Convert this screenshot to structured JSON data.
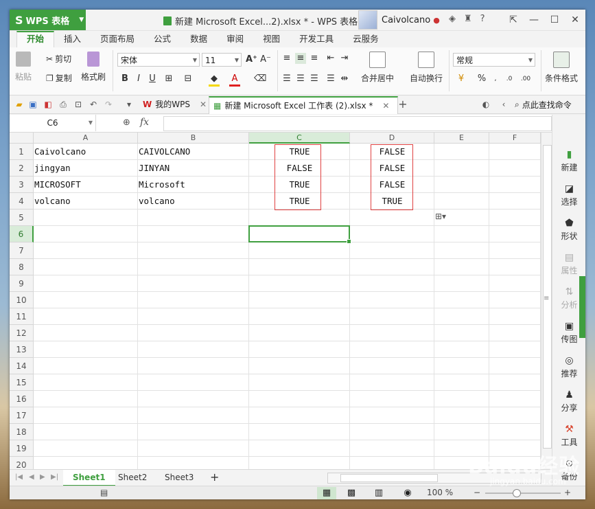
{
  "titlebar": {
    "app_name": "WPS 表格",
    "document_title": "新建 Microsoft Excel...2).xlsx * - WPS 表格",
    "username": "Caivolcano"
  },
  "ribbon_tabs": [
    "开始",
    "插入",
    "页面布局",
    "公式",
    "数据",
    "审阅",
    "视图",
    "开发工具",
    "云服务"
  ],
  "ribbon": {
    "paste": "粘贴",
    "cut": "剪切",
    "copy": "复制",
    "format_painter": "格式刷",
    "font_name": "宋体",
    "font_size": "11",
    "merge_center": "合并居中",
    "wrap_text": "自动换行",
    "number_format": "常规",
    "conditional_format": "条件格式"
  },
  "doc_tabs": {
    "my_wps": "我的WPS",
    "workbook": "新建 Microsoft Excel 工作表 (2).xlsx *",
    "search": "点此查找命令"
  },
  "formula_bar": {
    "name_box": "C6",
    "fx": "fx",
    "formula": ""
  },
  "sheet": {
    "columns": [
      "A",
      "B",
      "C",
      "D",
      "E",
      "F"
    ],
    "rows": [
      "1",
      "2",
      "3",
      "4",
      "5",
      "6",
      "7",
      "8",
      "9",
      "10",
      "11",
      "12",
      "13",
      "14",
      "15",
      "16",
      "17",
      "18",
      "19",
      "20"
    ],
    "selected_cell": "C6",
    "cells": [
      [
        "Caivolcano",
        "CAIVOLCANO",
        "TRUE",
        "FALSE"
      ],
      [
        "jingyan",
        "JINYAN",
        "FALSE",
        "FALSE"
      ],
      [
        "MICROSOFT",
        "Microsoft",
        "TRUE",
        "FALSE"
      ],
      [
        "volcano",
        "volcano",
        "TRUE",
        "TRUE"
      ]
    ]
  },
  "side_panel": [
    "新建",
    "选择",
    "形状",
    "属性",
    "分析",
    "传图",
    "推荐",
    "分享",
    "工具",
    "备份"
  ],
  "sheet_tabs": [
    "Sheet1",
    "Sheet2",
    "Sheet3"
  ],
  "statusbar": {
    "zoom": "100 %"
  },
  "watermark": {
    "brand": "Baidu经验",
    "url": "jingyan.baidu.com"
  },
  "colors": {
    "accent": "#3f9f3f",
    "highlight_box": "#e04040"
  }
}
